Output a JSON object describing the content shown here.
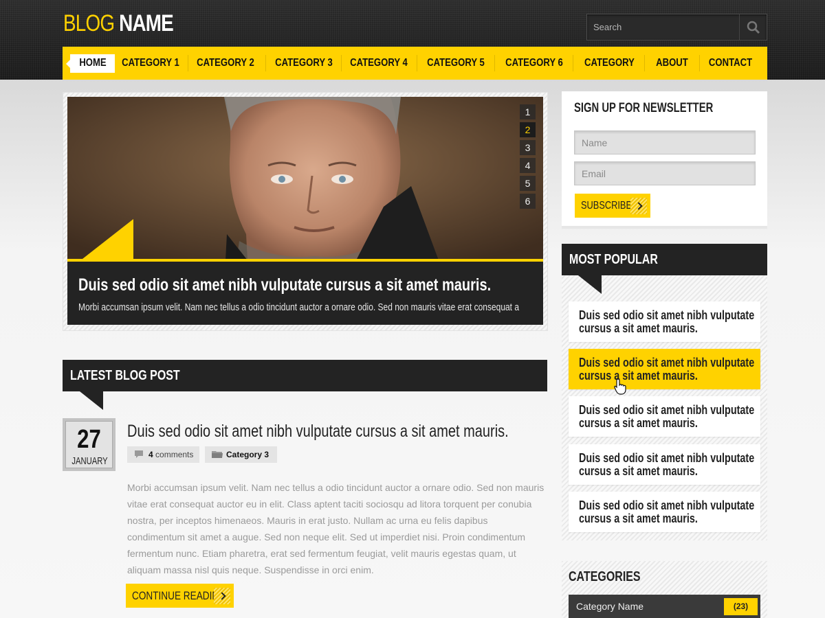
{
  "logo": {
    "blog": "BLOG",
    "name": "NAME"
  },
  "search": {
    "placeholder": "Search"
  },
  "nav": {
    "items": [
      "HOME",
      "CATEGORY 1",
      "CATEGORY 2",
      "CATEGORY 3",
      "CATEGORY 4",
      "CATEGORY 5",
      "CATEGORY 6",
      "CATEGORY",
      "ABOUT",
      "CONTACT"
    ],
    "active": "HOME"
  },
  "slider": {
    "caption_title": "Duis sed odio sit amet nibh vulputate cursus a sit amet mauris.",
    "caption_text": "Morbi accumsan ipsum velit. Nam nec tellus a odio tincidunt auctor a ornare odio. Sed non  mauris vitae erat consequat a",
    "pages": [
      "1",
      "2",
      "3",
      "4",
      "5",
      "6"
    ],
    "active_page": "2"
  },
  "latest": {
    "section_title": "LATEST BLOG POST",
    "date_day": "27",
    "date_month": "JANUARY",
    "post_title": "Duis sed odio sit amet nibh vulputate cursus a sit amet mauris.",
    "comments_count": "4",
    "comments_label": "comments",
    "category": "Category 3",
    "body": "Morbi accumsan ipsum velit. Nam nec tellus a odio tincidunt auctor a ornare odio. Sed non  mauris vitae erat consequat auctor eu in elit. Class aptent taciti sociosqu ad litora torquent per conubia nostra, per inceptos himenaeos. Mauris in erat justo. Nullam ac urna eu felis dapibus condimentum sit amet a augue. Sed non neque elit. Sed ut imperdiet nisi. Proin condimentum fermentum nunc. Etiam pharetra, erat sed fermentum feugiat, velit mauris egestas quam, ut aliquam massa nisl quis neque. Suspendisse in orci enim.",
    "continue_label": "CONTINUE READING"
  },
  "newsletter": {
    "title": "SIGN UP FOR NEWSLETTER",
    "name_placeholder": "Name",
    "email_placeholder": "Email",
    "subscribe_label": "SUBSCRIBE"
  },
  "popular": {
    "title": "MOST POPULAR",
    "items": [
      "Duis sed odio sit amet nibh vulputate cursus a sit amet mauris.",
      "Duis sed odio sit amet nibh vulputate cursus a sit amet mauris.",
      "Duis sed odio sit amet nibh vulputate cursus a sit amet mauris.",
      "Duis sed odio sit amet nibh vulputate cursus a sit amet mauris.",
      "Duis sed odio sit amet nibh vulputate cursus a sit amet mauris."
    ]
  },
  "categories": {
    "title": "CATEGORIES",
    "items": [
      {
        "name": "Category Name",
        "count": "(23)"
      }
    ]
  },
  "colors": {
    "accent": "#ffd200",
    "dark": "#232323",
    "body_text": "#9a9a9a"
  }
}
